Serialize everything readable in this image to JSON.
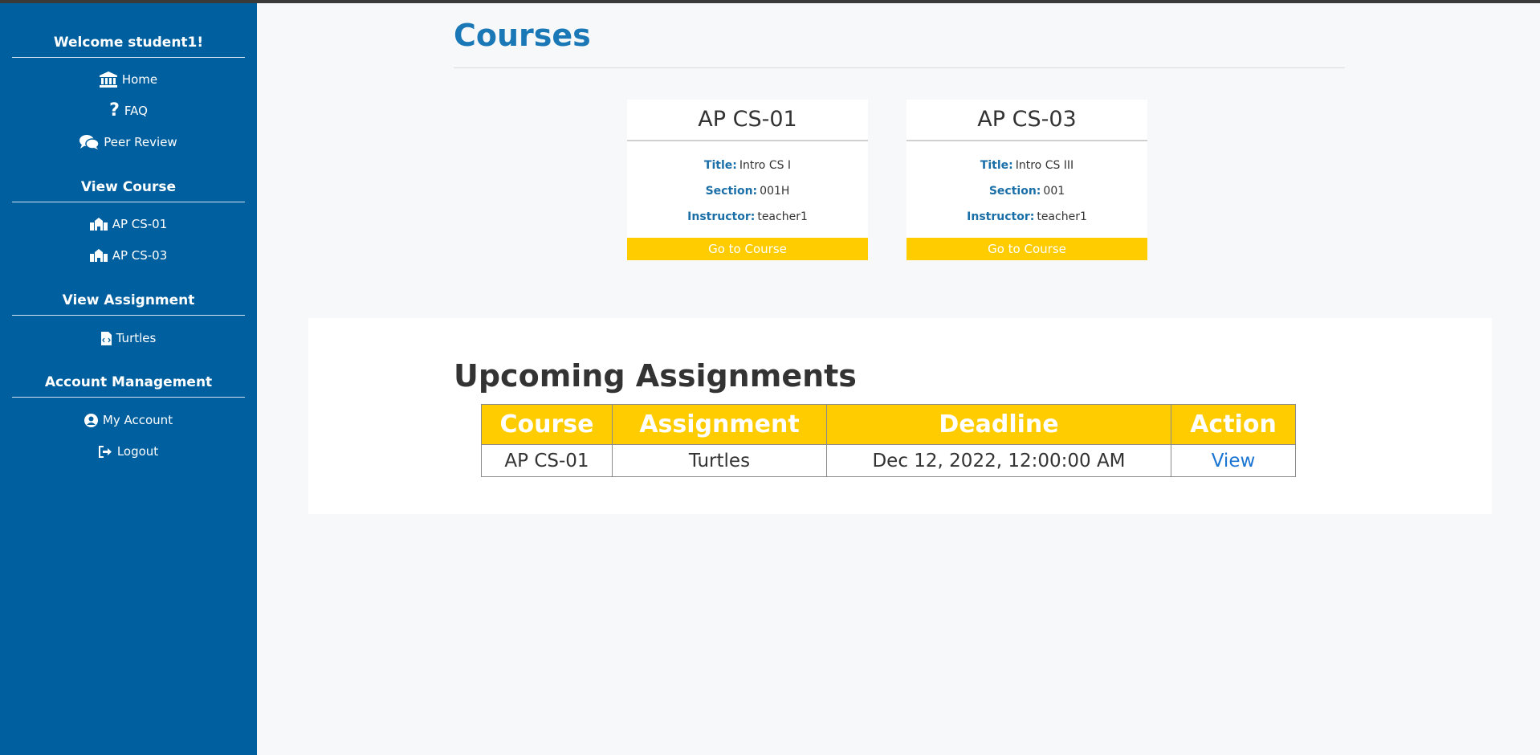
{
  "sidebar": {
    "welcome": "Welcome student1!",
    "nav": [
      {
        "label": "Home",
        "icon": "bank-icon"
      },
      {
        "label": "FAQ",
        "icon": "question-icon"
      },
      {
        "label": "Peer Review",
        "icon": "comments-icon"
      }
    ],
    "view_course_heading": "View Course",
    "courses": [
      {
        "label": "AP CS-01",
        "icon": "school-icon"
      },
      {
        "label": "AP CS-03",
        "icon": "school-icon"
      }
    ],
    "view_assignment_heading": "View Assignment",
    "assignments": [
      {
        "label": "Turtles",
        "icon": "file-code-icon"
      }
    ],
    "account_heading": "Account Management",
    "account": [
      {
        "label": "My Account",
        "icon": "user-circle-icon"
      },
      {
        "label": "Logout",
        "icon": "sign-out-icon"
      }
    ]
  },
  "main": {
    "courses_title": "Courses",
    "title_label": "Title:",
    "section_label": "Section:",
    "instructor_label": "Instructor:",
    "cards": [
      {
        "name": "AP CS-01",
        "title": "Intro CS I",
        "section": "001H",
        "instructor": "teacher1",
        "button": "Go to Course"
      },
      {
        "name": "AP CS-03",
        "title": "Intro CS III",
        "section": "001",
        "instructor": "teacher1",
        "button": "Go to Course"
      }
    ],
    "upcoming_title": "Upcoming Assignments",
    "table": {
      "headers": [
        "Course",
        "Assignment",
        "Deadline",
        "Action"
      ],
      "rows": [
        [
          "AP CS-01",
          "Turtles",
          "Dec 12, 2022, 12:00:00 AM",
          "View"
        ]
      ]
    }
  },
  "colors": {
    "sidebar": "#005f9e",
    "accent": "#ffcc00",
    "heading_blue": "#1b78b7",
    "link": "#1a75d2"
  }
}
